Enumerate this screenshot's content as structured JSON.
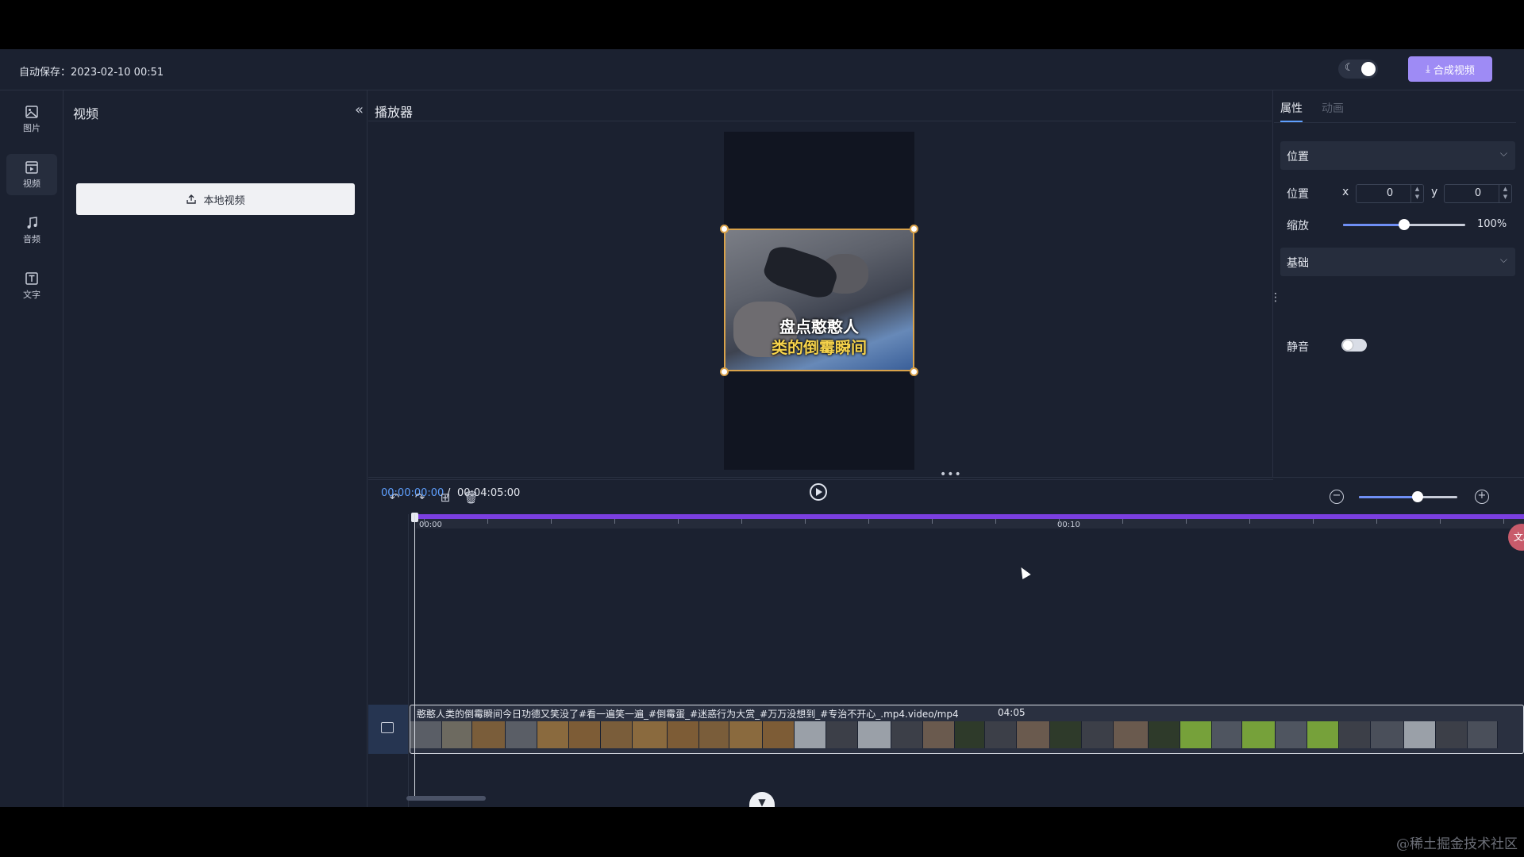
{
  "header": {
    "autosave_label": "自动保存：2023-02-10 00:51",
    "compose_button": "合成视频",
    "compose_icon": "download-icon"
  },
  "rail": {
    "items": [
      {
        "label": "图片",
        "icon": "image-icon"
      },
      {
        "label": "视频",
        "icon": "video-icon",
        "active": true
      },
      {
        "label": "音频",
        "icon": "music-icon"
      },
      {
        "label": "文字",
        "icon": "text-icon"
      }
    ]
  },
  "panel": {
    "title": "视频",
    "upload_button": "本地视频"
  },
  "player": {
    "title": "播放器",
    "caption_line1": "盘点憨憨人",
    "caption_line2": "类的倒霉瞬间",
    "time_current": "00:00:00:00",
    "time_separator": "/",
    "time_total": "00:04:05:00"
  },
  "props": {
    "tab_attributes": "属性",
    "tab_animation": "动画",
    "section_position": "位置",
    "position_label": "位置",
    "x_label": "x",
    "x_value": "0",
    "y_label": "y",
    "y_value": "0",
    "scale_label": "缩放",
    "scale_value": "100%",
    "scale_slider_fraction": 0.5,
    "section_basic": "基础",
    "mute_label": "静音",
    "mute_on": false
  },
  "timeline": {
    "ruler_labels": [
      "00:00",
      "00:10"
    ],
    "clip_title": "憨憨人类的倒霉瞬间今日功德又笑没了#看一遍笑一遍_#倒霉蛋_#迷惑行为大赏_#万万没想到_#专治不开心_.mp4.video/mp4",
    "clip_duration": "04:05",
    "zoom_fraction": 0.6,
    "side_badge": "文A"
  },
  "watermark": "@稀土掘金技术社区"
}
